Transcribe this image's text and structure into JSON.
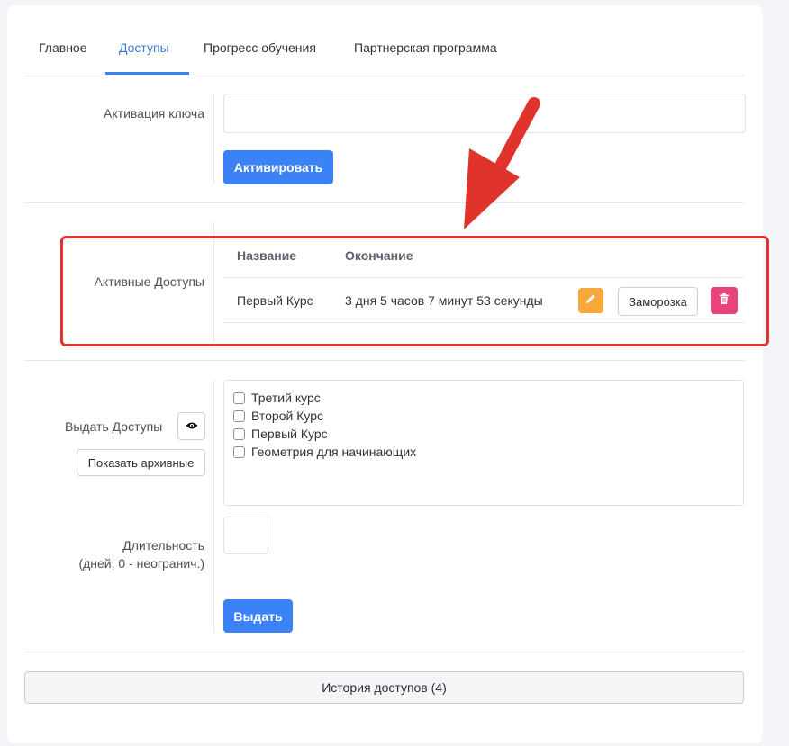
{
  "tabs": [
    {
      "label": "Главное"
    },
    {
      "label": "Доступы",
      "active": true
    },
    {
      "label": "Прогресс обучения"
    },
    {
      "label": "Партнерская программа"
    }
  ],
  "key_activation": {
    "label": "Активация ключа",
    "input_value": "",
    "button_label": "Активировать"
  },
  "active_access": {
    "label": "Активные Доступы",
    "columns": [
      "Название",
      "Окончание"
    ],
    "rows": [
      {
        "name": "Первый Курс",
        "ends": "3 дня 5 часов 7 минут 53 секунды",
        "freeze_label": "Заморозка"
      }
    ]
  },
  "grant_access": {
    "label": "Выдать Доступы",
    "show_archived_label": "Показать архивные",
    "courses": [
      "Третий курс",
      "Второй Курс",
      "Первый Курс",
      "Геометрия для начинающих"
    ]
  },
  "duration": {
    "label_line1": "Длительность",
    "label_line2": "(дней, 0 - неогранич.)",
    "input_value": ""
  },
  "grant_button_label": "Выдать",
  "history_button_label": "История доступов (4)",
  "colors": {
    "primary": "#3b82f6",
    "edit": "#f6a93b",
    "delete": "#e8437a",
    "annotation": "#e0332b"
  },
  "icons": {
    "edit": "pencil-icon",
    "delete": "trash-icon",
    "preview": "eye-icon",
    "annotation": "arrow-pointer"
  }
}
